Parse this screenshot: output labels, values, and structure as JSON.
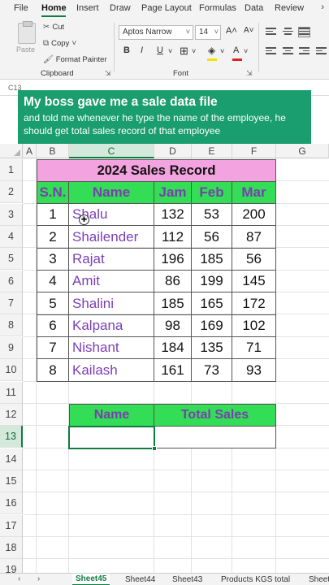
{
  "menu": {
    "tabs": [
      "File",
      "Home",
      "Insert",
      "Draw",
      "Page Layout",
      "Formulas",
      "Data",
      "Review"
    ],
    "active": "Home"
  },
  "ribbon": {
    "clipboard": {
      "paste": "Paste",
      "cut": "Cut",
      "copy": "Copy",
      "format_painter": "Format Painter",
      "label": "Clipboard"
    },
    "font": {
      "family": "Aptos Narrow",
      "size": "14",
      "grow": "A˄",
      "shrink": "A˅",
      "bold": "B",
      "italic": "I",
      "underline": "U",
      "label": "Font",
      "highlight_color": "#f5e200",
      "font_color": "#e02020"
    }
  },
  "formula_bar": {
    "cell_ref": "C13"
  },
  "banner": {
    "title": "My boss gave me a sale data file",
    "subtitle": "and told me whenever he type the name of the employee, he should get total sales record of that employee"
  },
  "columns": [
    "A",
    "B",
    "C",
    "D",
    "E",
    "F",
    "G"
  ],
  "rows": [
    "1",
    "2",
    "3",
    "4",
    "5",
    "6",
    "7",
    "8",
    "9",
    "10",
    "11",
    "12",
    "13",
    "14",
    "15",
    "16",
    "17",
    "18",
    "19"
  ],
  "table": {
    "title": "2024 Sales Record",
    "headers": [
      "S.N.",
      "Name",
      "Jam",
      "Feb",
      "Mar"
    ],
    "records": [
      [
        "1",
        "Shalu",
        "132",
        "53",
        "200"
      ],
      [
        "2",
        "Shailender",
        "112",
        "56",
        "87"
      ],
      [
        "3",
        "Rajat",
        "196",
        "185",
        "56"
      ],
      [
        "4",
        "Amit",
        "86",
        "199",
        "145"
      ],
      [
        "5",
        "Shalini",
        "185",
        "165",
        "172"
      ],
      [
        "6",
        "Kalpana",
        "98",
        "169",
        "102"
      ],
      [
        "7",
        "Nishant",
        "184",
        "135",
        "71"
      ],
      [
        "8",
        "Kailash",
        "161",
        "73",
        "93"
      ]
    ]
  },
  "lookup": {
    "name_header": "Name",
    "total_header": "Total Sales"
  },
  "sheets": [
    "Sheet45",
    "Sheet44",
    "Sheet43",
    "Products KGS total",
    "Sheet"
  ],
  "active_sheet": "Sheet45",
  "colors": {
    "accent": "#107c41",
    "banner": "#1a9e6f",
    "header_fill": "#33dd55",
    "title_fill": "#f3a3e0",
    "name_text": "#7b3fb5"
  }
}
